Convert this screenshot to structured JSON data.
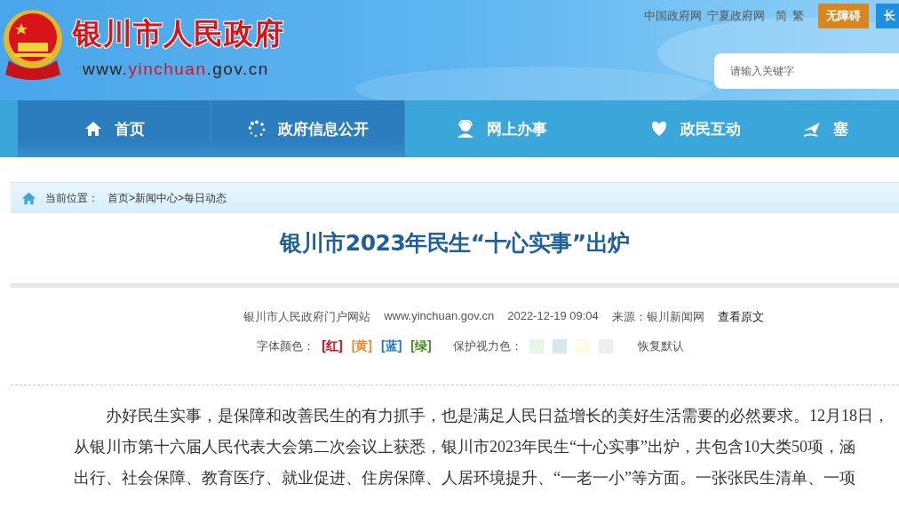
{
  "header": {
    "site_name": "银川市人民政府",
    "domain_parts": [
      "www.",
      "yinchuan",
      ".gov.cn"
    ],
    "links": [
      "中国政府网",
      "宁夏政府网",
      "简",
      "繁"
    ],
    "buttons": [
      {
        "label": "无障碍",
        "color": "#d9861f"
      },
      {
        "label": "长",
        "color": "#1f8fe0"
      }
    ],
    "search": {
      "placeholder": "请输入关键字"
    }
  },
  "nav": [
    {
      "label": "首页",
      "kind": "home",
      "selected": true
    },
    {
      "label": "政府信息公开",
      "kind": "info",
      "selected": true
    },
    {
      "label": "网上办事",
      "kind": "service",
      "selected": false
    },
    {
      "label": "政民互动",
      "kind": "interaction",
      "selected": false
    },
    {
      "label": "塞",
      "kind": "feature",
      "selected": false
    }
  ],
  "breadcrumb": {
    "label": "当前位置：",
    "items": [
      "首页",
      ">",
      "新闻中心",
      ">",
      "每日动态"
    ]
  },
  "article": {
    "title": "银川市2023年民生“十心实事”出炉",
    "meta": [
      "银川市人民政府门户网站",
      "www.yinchuan.gov.cn",
      "2022-12-19 09:04",
      "来源：银川新闻网"
    ],
    "view_original": "查看原文",
    "font_color_label": "字体颜色：",
    "font_colors": [
      {
        "label": "[红]",
        "color": "#e60012"
      },
      {
        "label": "[黄]",
        "color": "#e38b2c"
      },
      {
        "label": "[蓝]",
        "color": "#1a73d0"
      },
      {
        "label": "[绿]",
        "color": "#3f8f1f"
      }
    ],
    "eye_color_label": "保护视力色：",
    "eye_colors": [
      {
        "color": "#e3f7e7"
      },
      {
        "color": "#d7e8ec"
      },
      {
        "color": "#fdfbe8"
      },
      {
        "color": "#eeeeee"
      }
    ],
    "reset": "恢复默认",
    "body_lines": [
      "办好民生实事，是保障和改善民生的有力抓手，也是满足人民日益增长的美好生活需要的必然要求。12月18日，",
      "从银川市第十六届人民代表大会第二次会议上获悉，银川市2023年民生“十心实事”出炉，共包含10大类50项，涵",
      "出行、社会保障、教育医疗、就业促进、住房保障、人居环境提升、“一老一小”等方面。一张张民生清单、一项"
    ]
  }
}
